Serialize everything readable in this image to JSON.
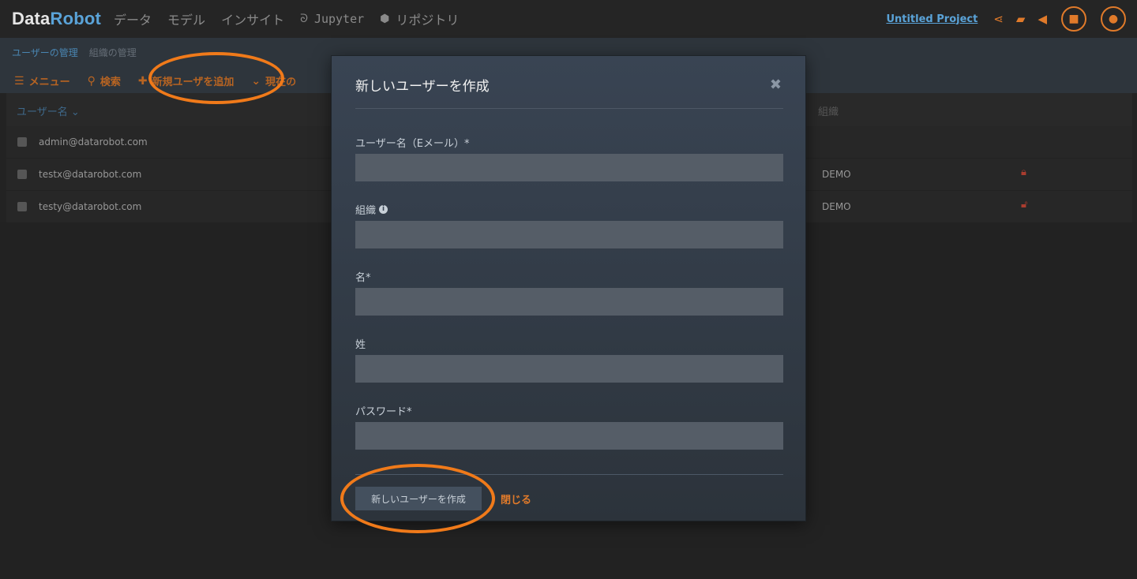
{
  "app": {
    "logo_part1": "Data",
    "logo_part2": "Robot",
    "project_name": "Untitled Project"
  },
  "nav": {
    "items": [
      {
        "label": "データ"
      },
      {
        "label": "モデル"
      },
      {
        "label": "インサイト"
      },
      {
        "label": "Jupyter",
        "icon": "jupyter-icon"
      },
      {
        "label": "リポジトリ",
        "icon": "cube-icon"
      }
    ]
  },
  "subnav": {
    "active_tab": "ユーザーの管理",
    "tab": "組織の管理"
  },
  "toolbar": {
    "menu_label": "メニュー",
    "search_label": "検索",
    "add_user_label": "新規ユーザを追加",
    "current_label": "現在の"
  },
  "table": {
    "col_username": "ユーザー名",
    "col_org": "組織",
    "rows": [
      {
        "email": "admin@datarobot.com",
        "org": "",
        "locked": null
      },
      {
        "email": "testx@datarobot.com",
        "org": "DEMO",
        "locked": true
      },
      {
        "email": "testy@datarobot.com",
        "org": "DEMO",
        "locked": false
      }
    ]
  },
  "modal": {
    "title": "新しいユーザーを作成",
    "fields": {
      "email_label": "ユーザー名（Eメール）*",
      "org_label": "組織",
      "first_name_label": "名*",
      "last_name_label": "姓",
      "password_label": "パスワード*"
    },
    "create_button": "新しいユーザーを作成",
    "close_link": "閉じる"
  },
  "colors": {
    "accent": "#e07a2a",
    "link_blue": "#5aa3d8",
    "annotation": "#f07a1a"
  }
}
